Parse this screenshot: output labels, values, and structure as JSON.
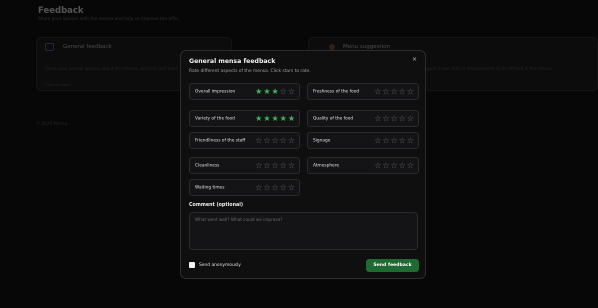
{
  "page": {
    "title": "Feedback",
    "subtitle": "Share your opinion with the mensa and help us improve the offer.",
    "footer": "© 2025 Mensa"
  },
  "cards": [
    {
      "title": "General feedback",
      "description": "Share your overall opinion about the mensa, services and food.",
      "link": "Click to open"
    },
    {
      "title": "Menu suggestion",
      "description": "Suggest a new dish or improvement to be offered in the mensa."
    }
  ],
  "modal": {
    "title": "General mensa feedback",
    "subtitle": "Rate different aspects of the mensa. Click stars to rate.",
    "close_label": "×",
    "ratings": [
      {
        "label": "Overall impression",
        "value": 3
      },
      {
        "label": "Freshness of the food",
        "value": 0
      },
      {
        "label": "Variety of the food",
        "value": 5
      },
      {
        "label": "Quality of the food",
        "value": 0
      },
      {
        "label": "Friendliness of the staff",
        "value": 0
      },
      {
        "label": "Signage",
        "value": 0
      },
      {
        "label": "Cleanliness",
        "value": 0
      },
      {
        "label": "Atmosphere",
        "value": 0
      },
      {
        "label": "Waiting times",
        "value": 0
      }
    ],
    "comment_label": "Comment (optional)",
    "comment_placeholder": "What went well? What could we improve?",
    "comment_value": "",
    "anonymous_label": "Send anonymously",
    "send_label": "Send feedback"
  },
  "colors": {
    "star_active": "#3fb55a",
    "star_inactive": "#6a6a6a",
    "send_button": "#1f6a32"
  }
}
